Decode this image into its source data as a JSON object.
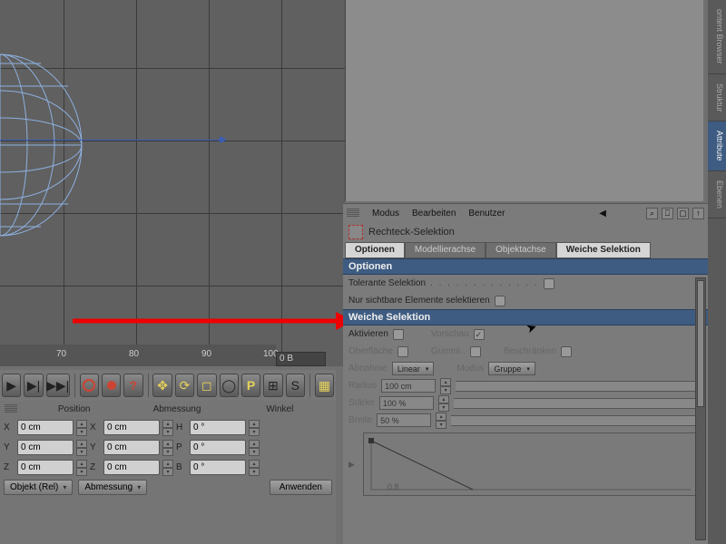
{
  "viewport": {
    "ruler": {
      "ticks": [
        "70",
        "80",
        "90",
        "100"
      ],
      "frame": "0 B"
    }
  },
  "toolbar": {
    "play": "▶",
    "skip": "▶|",
    "end": "▶▶|",
    "key": "◯",
    "rec": "◉",
    "help": "?",
    "move": "✥",
    "rot": "⟳",
    "scale": "◻",
    "axis": "◯",
    "p": "P",
    "snap": "⊞",
    "s": "S",
    "render": "▦"
  },
  "coord": {
    "heads": [
      "Position",
      "Abmessung",
      "Winkel"
    ],
    "rows": [
      [
        "X",
        "0 cm",
        "X",
        "0 cm",
        "H",
        "0 °"
      ],
      [
        "Y",
        "0 cm",
        "Y",
        "0 cm",
        "P",
        "0 °"
      ],
      [
        "Z",
        "0 cm",
        "Z",
        "0 cm",
        "B",
        "0 °"
      ]
    ],
    "obj_mode": "Objekt (Rel)",
    "size_mode": "Abmessung",
    "apply": "Anwenden"
  },
  "attr": {
    "menus": [
      "Modus",
      "Bearbeiten",
      "Benutzer"
    ],
    "tool_name": "Rechteck-Selektion",
    "tabs": [
      "Optionen",
      "Modellierachse",
      "Objektachse",
      "Weiche Selektion"
    ],
    "section_options": "Optionen",
    "tolerant": "Tolerante Selektion",
    "visible_only": "Nur sichtbare Elemente selektieren",
    "section_soft": "Weiche Selektion",
    "soft": {
      "activate": "Aktivieren",
      "preview": "Vorschau",
      "surface": "Oberfläche",
      "rubber": "Gummi..",
      "limit": "Beschränken",
      "falloff_lbl": "Abnahme",
      "falloff": "Linear",
      "mode_lbl": "Modus",
      "mode": "Gruppe",
      "radius_lbl": "Radius",
      "radius": "100 cm",
      "strength_lbl": "Stärke",
      "strength": "100 %",
      "width_lbl": "Breite",
      "width": "50 %"
    },
    "curve_tick": "0.8"
  },
  "side_tabs": [
    "ontent Browser",
    "Struktur",
    "Attribute",
    "Ebenen"
  ]
}
